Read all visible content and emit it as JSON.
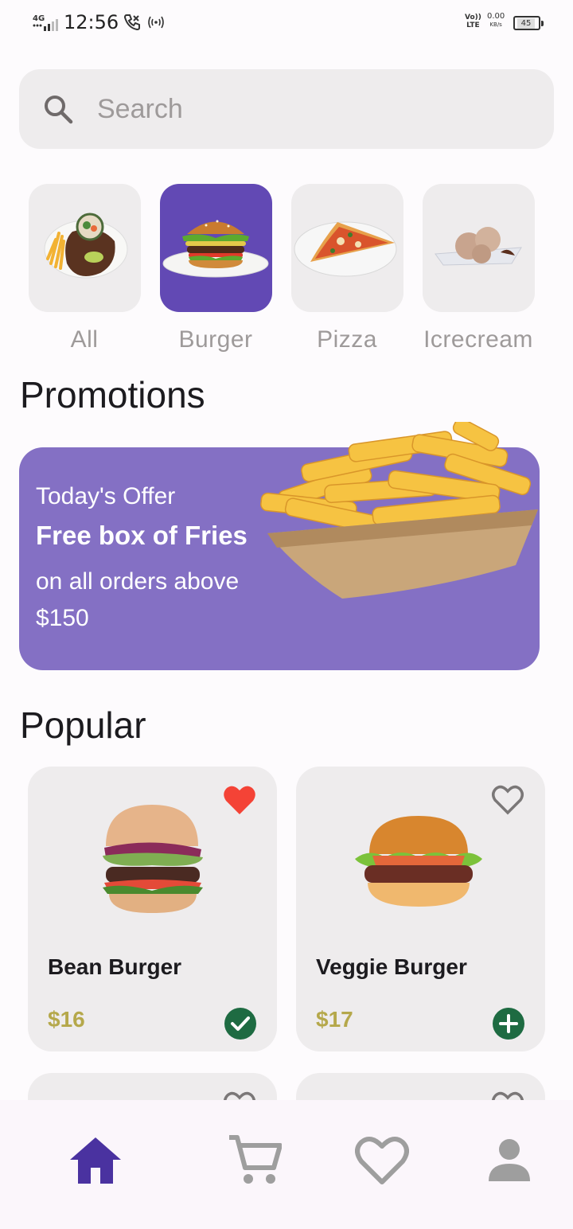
{
  "status_bar": {
    "network": "4G",
    "time": "12:56",
    "volte_line1": "Vo))",
    "volte_line2": "LTE",
    "speed_value": "0.00",
    "speed_unit": "KB/s",
    "battery": "45"
  },
  "search": {
    "placeholder": "Search",
    "icon": "search-icon"
  },
  "categories": [
    {
      "label": "All",
      "selected": false,
      "icon": "steak-plate-image"
    },
    {
      "label": "Burger",
      "selected": true,
      "icon": "burger-plate-image"
    },
    {
      "label": "Pizza",
      "selected": false,
      "icon": "pizza-slice-image"
    },
    {
      "label": "Icrecream",
      "selected": false,
      "icon": "icecream-plate-image"
    }
  ],
  "promotions": {
    "title": "Promotions",
    "line1": "Today's Offer",
    "line2": "Free box of Fries",
    "line3": "on all orders above $150",
    "image": "fries-box-image"
  },
  "popular": {
    "title": "Popular",
    "items": [
      {
        "name": "Bean Burger",
        "price": "$16",
        "favorite": true,
        "in_cart": true
      },
      {
        "name": "Veggie Burger",
        "price": "$17",
        "favorite": false,
        "in_cart": false
      }
    ]
  },
  "nav": {
    "items": [
      {
        "icon": "home-icon",
        "active": true
      },
      {
        "icon": "cart-icon",
        "active": false
      },
      {
        "icon": "heart-icon",
        "active": false
      },
      {
        "icon": "person-icon",
        "active": false
      }
    ]
  },
  "colors": {
    "accent": "#6249b4",
    "promo_bg": "#8470c4",
    "card_bg": "#eeeced",
    "price": "#b5a84b",
    "favorite": "#f44336",
    "success": "#1e6b42",
    "nav_active": "#4a32a0",
    "nav_inactive": "#9e9e9e"
  }
}
